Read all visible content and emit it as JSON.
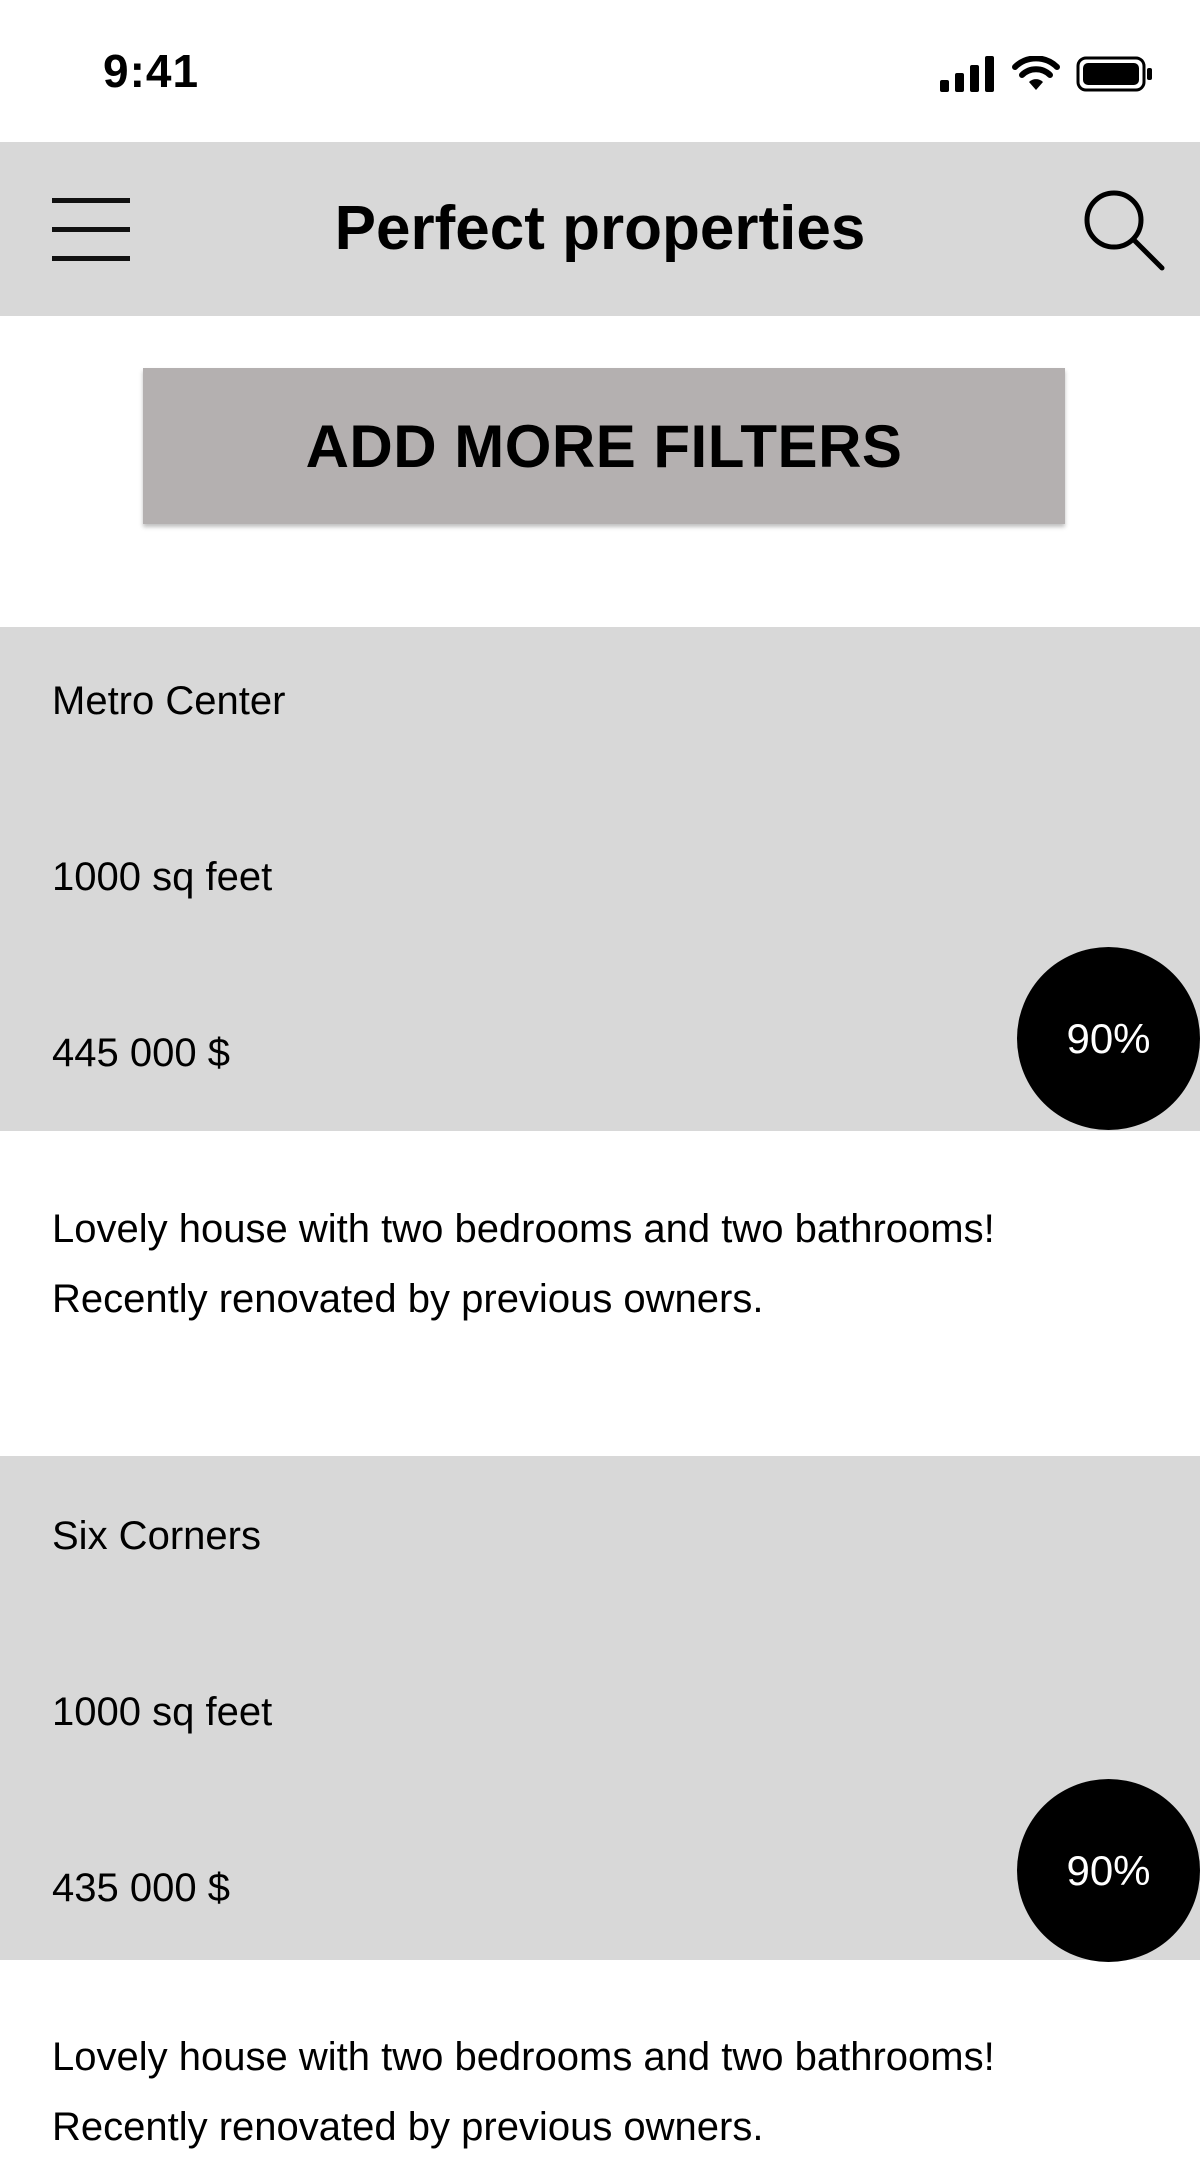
{
  "status_bar": {
    "time": "9:41",
    "icons": [
      "signal-icon",
      "wifi-icon",
      "battery-icon"
    ]
  },
  "header": {
    "title": "Perfect properties",
    "menu_icon": "hamburger-menu-icon",
    "search_icon": "search-icon",
    "background": "#d8d8d8"
  },
  "filters_button": {
    "label": "ADD MORE FILTERS",
    "background": "#b4b0b0"
  },
  "listings": [
    {
      "name": "Metro Center",
      "area": "1000 sq feet",
      "price": "445 000 $",
      "match": "90%",
      "description_lines": [
        "Lovely house with two bedrooms and two bathrooms!",
        "Recently renovated by previous owners."
      ]
    },
    {
      "name": "Six Corners",
      "area": "1000 sq feet",
      "price": "435 000 $",
      "match": "90%",
      "description_lines": [
        "Lovely house with two bedrooms and two bathrooms!",
        "Recently renovated by previous owners."
      ]
    }
  ]
}
